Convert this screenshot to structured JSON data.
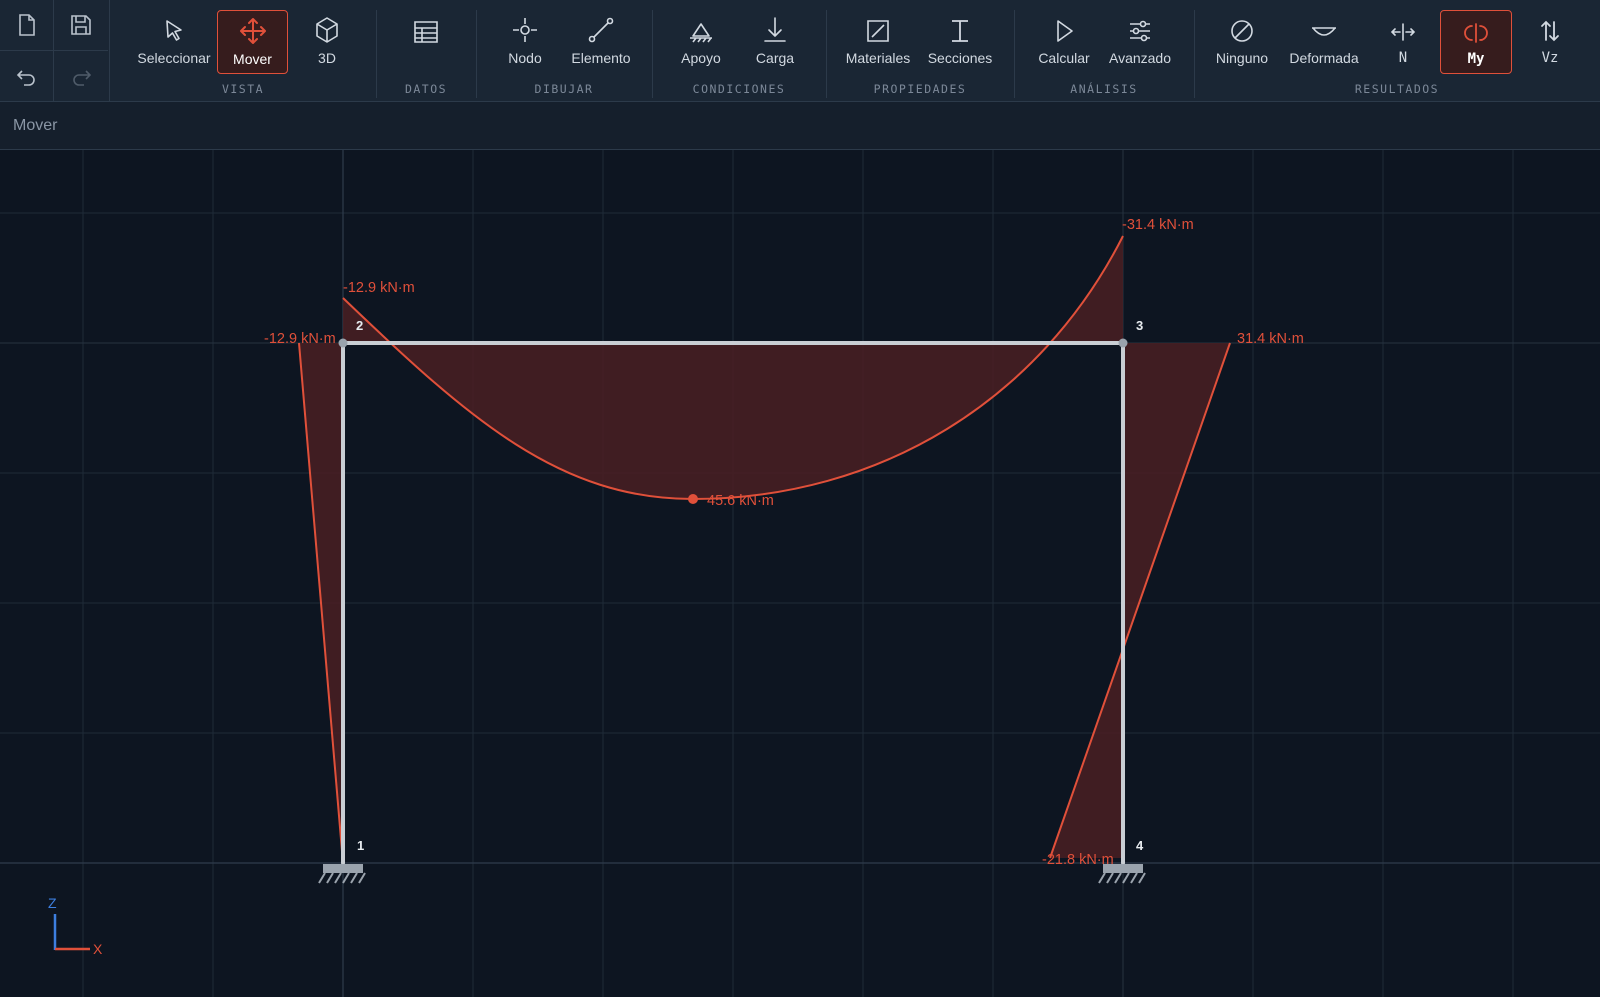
{
  "file": {
    "new_icon": "file-icon",
    "save_icon": "save-icon",
    "undo_icon": "undo-icon",
    "redo_icon": "redo-icon"
  },
  "toolbar": {
    "tools": {
      "seleccionar": "Seleccionar",
      "mover": "Mover",
      "vista3d": "3D",
      "nodo": "Nodo",
      "elemento": "Elemento",
      "apoyo": "Apoyo",
      "carga": "Carga",
      "materiales": "Materiales",
      "secciones": "Secciones",
      "calcular": "Calcular",
      "avanzado": "Avanzado",
      "ninguno": "Ninguno",
      "deformada": "Deformada",
      "n": "N",
      "my": "My",
      "vz": "Vz"
    },
    "groups": {
      "vista": "VISTA",
      "datos": "DATOS",
      "dibujar": "DIBUJAR",
      "condiciones": "CONDICIONES",
      "propiedades": "PROPIEDADES",
      "analisis": "ANÁLISIS",
      "resultados": "RESULTADOS"
    },
    "active_tool": "Mover",
    "active_result": "My"
  },
  "status": {
    "mode": "Mover"
  },
  "colors": {
    "accent": "#e0503a",
    "diagram_fill": "#4a1f22",
    "member": "#c9ced4",
    "axis_z": "#3d7fe0",
    "axis_x": "#e0503a"
  },
  "structure": {
    "nodes": [
      "1",
      "2",
      "3",
      "4"
    ],
    "moment_labels": {
      "node2_top": "-12.9 kN·m",
      "node2_left": "-12.9 kN·m",
      "node3_top": "-31.4 kN·m",
      "node3_right": "31.4 kN·m",
      "beam_mid": "45.6 kN·m",
      "node4_base": "-21.8 kN·m"
    }
  },
  "axes": {
    "z": "Z",
    "x": "X"
  }
}
